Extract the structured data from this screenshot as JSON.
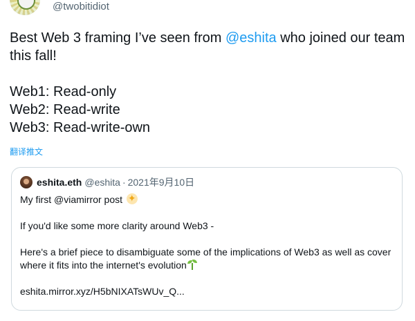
{
  "author": {
    "handle": "@twobitidiot"
  },
  "tweet": {
    "line1_before": "Best Web 3 framing I’ve seen from ",
    "mention": "@eshita",
    "line1_after": " who joined our team this fall!",
    "definitions": [
      "Web1: Read-only",
      "Web2: Read-write",
      "Web3: Read-write-own"
    ],
    "translate_label": "翻译推文"
  },
  "quote": {
    "name": "eshita.eth",
    "handle": "@eshita",
    "separator": "·",
    "date": "2021年9月10日",
    "line1": "My first @viamirror post",
    "line2": "If you'd like some more clarity around Web3 -",
    "line3": "Here's a brief piece to disambiguate some of the implications of Web3 as well as cover where it fits into the internet's evolution",
    "link": "eshita.mirror.xyz/H5bNIXATsWUv_Q..."
  },
  "colors": {
    "link_blue": "#1d9bf0",
    "secondary_text": "#536471",
    "border": "#cfd9de"
  },
  "icons": [
    "sparkle-emoji",
    "seedling-emoji"
  ]
}
